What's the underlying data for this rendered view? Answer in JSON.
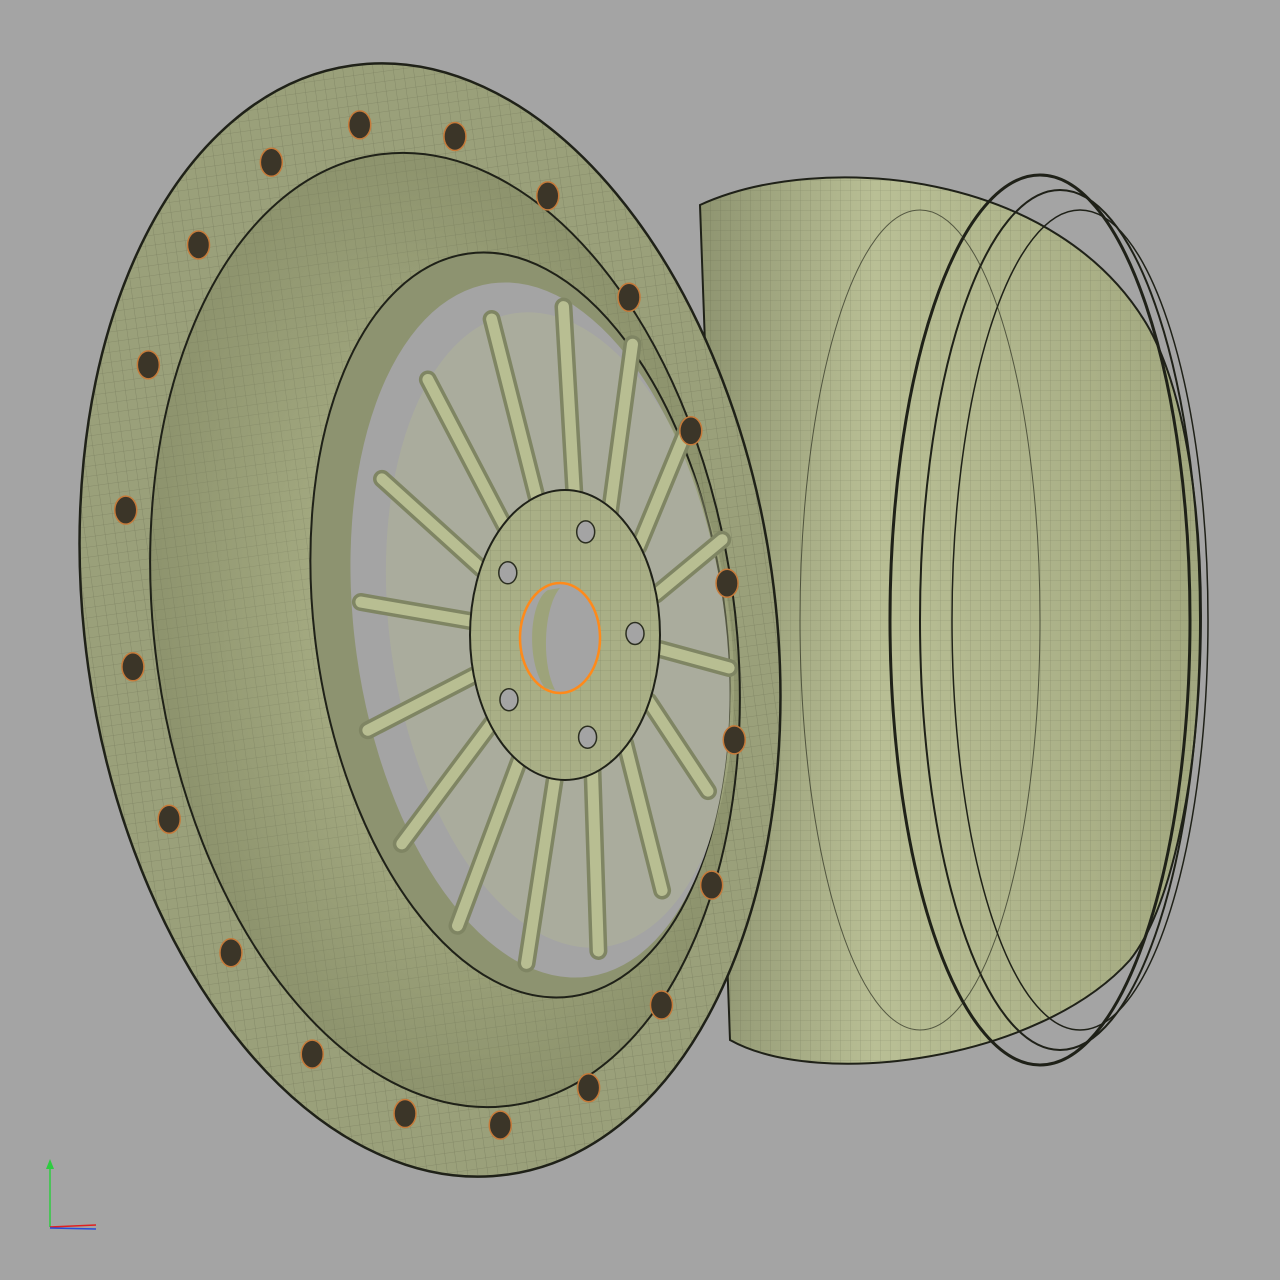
{
  "viewport": {
    "background": "#a4a4a4"
  },
  "model": {
    "part": "two-piece-split-rim-wheel",
    "spoke_count": 16,
    "rim_bolt_count": 20,
    "hub_lug_holes": 5,
    "surface_color": "#b8be92",
    "surface_dark": "#7f8563",
    "mesh_line_color": "#2b2e20",
    "selected_edge_color": "#ff8a1a",
    "bolt_color": "#3b3528",
    "bolt_highlight": "#c57a3a"
  },
  "triad": {
    "up_axis_color": "#2ecc40",
    "right_axis_color": "#e02020",
    "depth_axis_color": "#2a4cd6"
  }
}
